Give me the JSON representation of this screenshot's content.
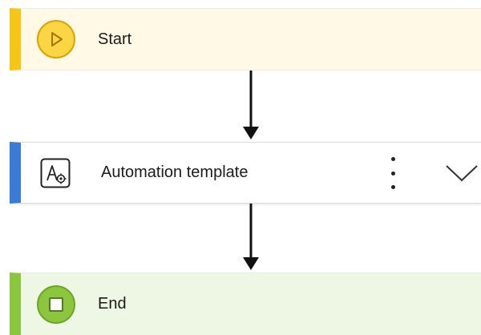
{
  "flow": {
    "steps": [
      {
        "label": "Start",
        "icon": "play-icon",
        "accent": "#f5c518"
      },
      {
        "label": "Automation template",
        "icon": "automation-template-icon",
        "accent": "#3a7bd5"
      },
      {
        "label": "End",
        "icon": "stop-icon",
        "accent": "#8cc63f"
      }
    ]
  },
  "icons": {
    "more": "vertical-ellipsis-icon",
    "expand": "chevron-down-icon",
    "connector": "arrow-down-icon"
  }
}
